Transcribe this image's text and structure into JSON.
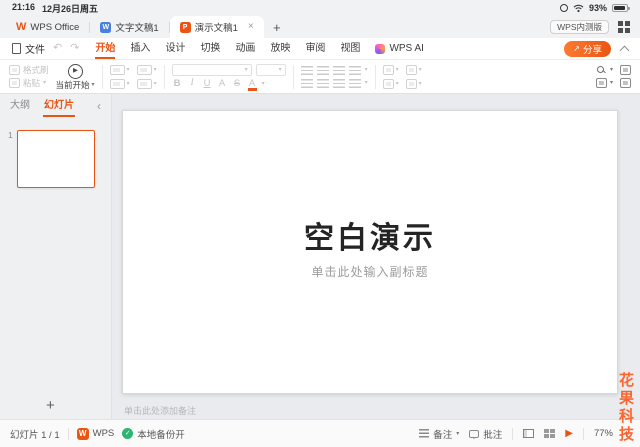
{
  "status_bar": {
    "time": "21:16",
    "date": "12月26日周五",
    "battery_percent": "93%"
  },
  "tab_bar": {
    "tabs": [
      {
        "label": "WPS Office"
      },
      {
        "label": "文字文稿1"
      },
      {
        "label": "演示文稿1"
      }
    ],
    "beta_button": "WPS内测版"
  },
  "ribbon": {
    "file_label": "文件",
    "tabs": [
      "开始",
      "插入",
      "设计",
      "切换",
      "动画",
      "放映",
      "审阅",
      "视图",
      "WPS AI"
    ],
    "share_label": "分享"
  },
  "toolbar": {
    "format_painter": "格式刷",
    "paste": "粘贴",
    "play_from_current": "当前开始",
    "font_icons": [
      "B",
      "I",
      "U",
      "A",
      "S"
    ],
    "font_color_letter": "A"
  },
  "sidebar": {
    "tab_outline": "大纲",
    "tab_slides": "幻灯片",
    "slide_number": "1"
  },
  "slide": {
    "title": "空白演示",
    "subtitle": "单击此处输入副标题"
  },
  "notes_placeholder": "单击此处添加备注",
  "footer": {
    "slide_counter": "幻灯片 1 / 1",
    "wps_label": "WPS",
    "backup_label": "本地备份开",
    "notes_label": "备注",
    "comments_label": "批注",
    "zoom": "77%"
  },
  "watermark": "花果科技",
  "icons": {
    "undo": "↶",
    "redo": "↷",
    "caret_down": "▾",
    "close": "×",
    "plus": "+",
    "check": "✓",
    "chevron_left": "‹",
    "play": "▶",
    "share_arrow": "↗",
    "wps_letter": "W",
    "writer_letter": "W",
    "presentation_letter": "P",
    "zoom_in": "+"
  },
  "colors": {
    "accent_orange": "#ea5514",
    "writer_blue": "#4a7fe0",
    "backup_green": "#2bb673",
    "watermark_orange": "#ff5a1e"
  }
}
